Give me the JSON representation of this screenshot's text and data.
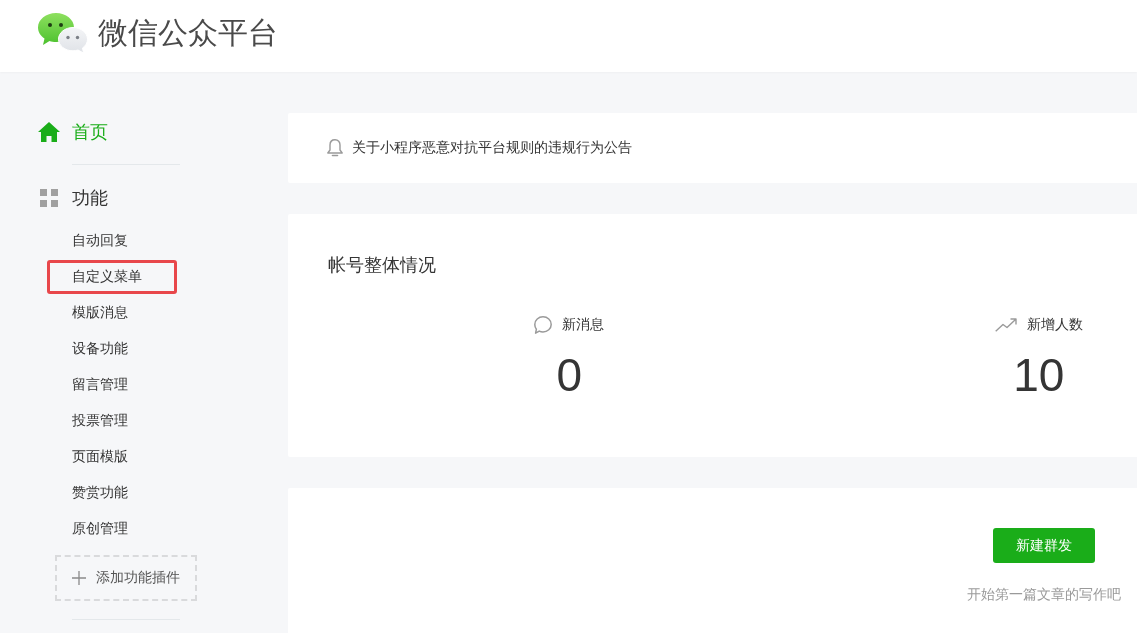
{
  "header": {
    "title": "微信公众平台"
  },
  "sidebar": {
    "home": {
      "label": "首页",
      "selected": true
    },
    "sections": [
      {
        "title": "功能",
        "items": [
          {
            "label": "自动回复",
            "selected": false,
            "annotated": false
          },
          {
            "label": "自定义菜单",
            "selected": false,
            "annotated": true
          },
          {
            "label": "模版消息",
            "selected": false,
            "annotated": false
          },
          {
            "label": "设备功能",
            "selected": false,
            "annotated": false
          },
          {
            "label": "留言管理",
            "selected": false,
            "annotated": false
          },
          {
            "label": "投票管理",
            "selected": false,
            "annotated": false
          },
          {
            "label": "页面模版",
            "selected": false,
            "annotated": false
          },
          {
            "label": "赞赏功能",
            "selected": false,
            "annotated": false
          },
          {
            "label": "原创管理",
            "selected": false,
            "annotated": false
          }
        ]
      }
    ],
    "add_plugin": {
      "label": "添加功能插件"
    }
  },
  "notice": {
    "text": "关于小程序恶意对抗平台规则的违规行为公告"
  },
  "account_overview": {
    "title": "帐号整体情况",
    "stats": [
      {
        "kind": "messages",
        "label": "新消息",
        "value": "0"
      },
      {
        "kind": "growth",
        "label": "新增人数",
        "value": "10"
      }
    ]
  },
  "publish": {
    "button": "新建群发",
    "hint": "开始第一篇文章的写作吧"
  }
}
